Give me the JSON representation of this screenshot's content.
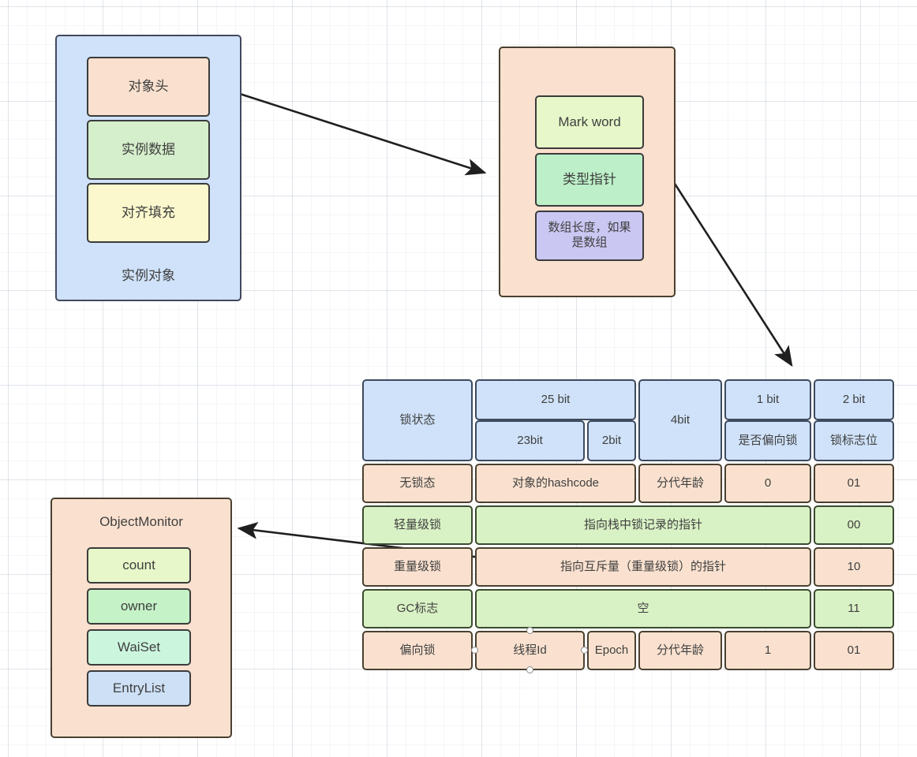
{
  "diagram": {
    "instance_object": {
      "group_label": "实例对象",
      "rows": [
        {
          "label": "对象头"
        },
        {
          "label": "实例数据"
        },
        {
          "label": "对齐填充"
        }
      ]
    },
    "object_header": {
      "rows": [
        {
          "label": "Mark word"
        },
        {
          "label": "类型指针"
        },
        {
          "label": "数组长度，如果是数组"
        }
      ]
    },
    "object_monitor": {
      "title": "ObjectMonitor",
      "fields": [
        {
          "label": "count"
        },
        {
          "label": "owner"
        },
        {
          "label": "WaiSet"
        },
        {
          "label": "EntryList"
        }
      ]
    },
    "markword_table": {
      "header": {
        "state_label": "锁状态",
        "bit25": "25 bit",
        "bit23": "23bit",
        "bit2": "2bit",
        "bit4": "4bit",
        "bit1": "1 bit",
        "biased_label": "是否偏向锁",
        "bit2_top": "2 bit",
        "flag_label": "锁标志位"
      },
      "rows": [
        {
          "state": "无锁态",
          "content": "对象的hashcode",
          "age": "分代年龄",
          "biased": "0",
          "flag": "01"
        },
        {
          "state": "轻量级锁",
          "content": "指向栈中锁记录的指针",
          "flag": "00"
        },
        {
          "state": "重量级锁",
          "content": "指向互斥量（重量级锁）的指针",
          "flag": "10"
        },
        {
          "state": "GC标志",
          "content": "空",
          "flag": "11"
        },
        {
          "state": "偏向锁",
          "thread_id": "线程Id",
          "epoch": "Epoch",
          "age": "分代年龄",
          "biased": "1",
          "flag": "01"
        }
      ]
    },
    "colors": {
      "blue_fill": "#cfe2f9",
      "peach_fill": "#fae1cf",
      "green_fill": "#d5eecb",
      "yellow_fill": "#fbf8cd",
      "purple_fill": "#cac7f3",
      "mint_fill": "#ccf5dd",
      "stroke": "#3b3b3b",
      "arrow": "#1f1f1f"
    }
  }
}
